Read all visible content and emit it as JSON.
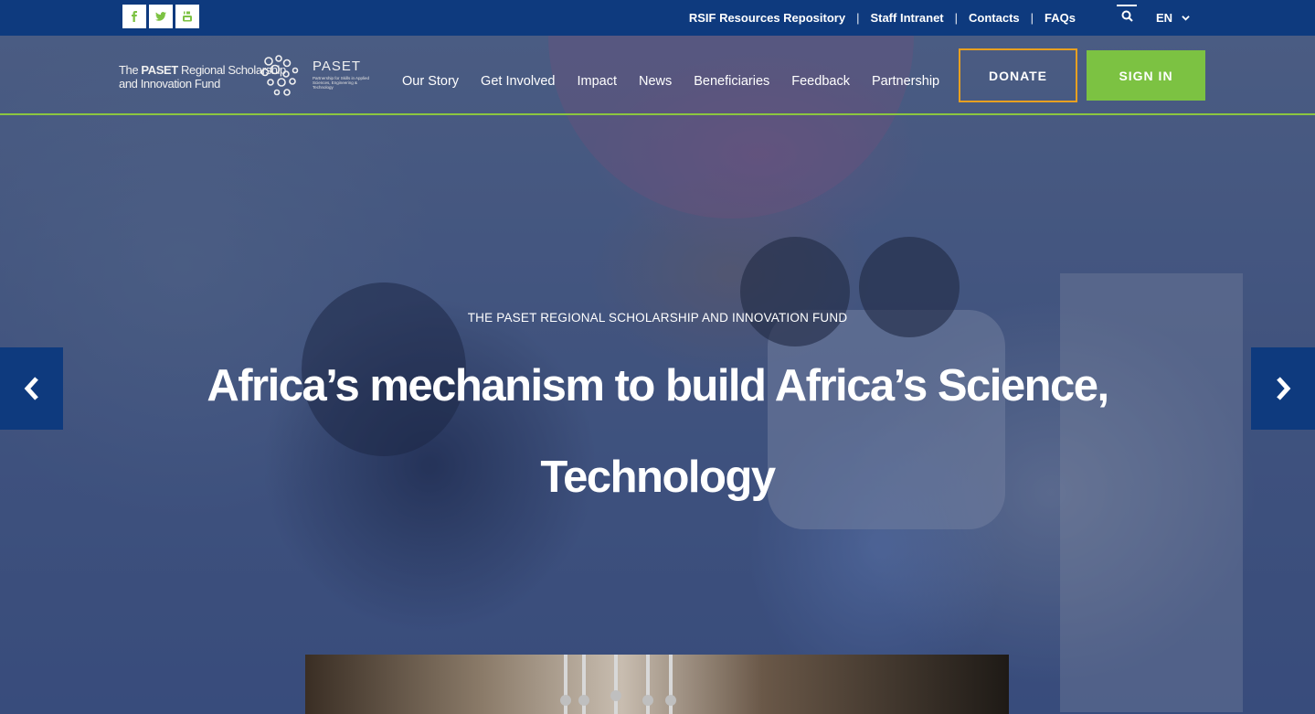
{
  "topbar": {
    "social": [
      {
        "icon": "facebook-icon"
      },
      {
        "icon": "twitter-icon"
      },
      {
        "icon": "youtube-icon"
      }
    ],
    "links": [
      {
        "label": "RSIF Resources Repository"
      },
      {
        "label": "Staff Intranet"
      },
      {
        "label": "Contacts"
      },
      {
        "label": "FAQs"
      }
    ],
    "separator": "|",
    "language": "EN"
  },
  "logo": {
    "line1_prefix": "The ",
    "line1_bold": "PASET",
    "line1_suffix": " Regional Scholarship",
    "line2": "and Innovation Fund",
    "paset": "PASET",
    "paset_sub": "Partnership for Skills in Applied Sciences, Engineering & Technology"
  },
  "nav": {
    "items": [
      {
        "label": "Our Story"
      },
      {
        "label": "Get Involved"
      },
      {
        "label": "Impact"
      },
      {
        "label": "News"
      },
      {
        "label": "Beneficiaries"
      },
      {
        "label": "Feedback"
      },
      {
        "label": "Partnership"
      }
    ],
    "donate": "DONATE",
    "signin": "SIGN IN"
  },
  "hero": {
    "eyebrow": "THE PASET REGIONAL SCHOLARSHIP AND INNOVATION FUND",
    "headline": "Africa’s mechanism to build Africa’s Science, Technology"
  },
  "colors": {
    "topbar": "#0e3a7e",
    "accent_green": "#7cc242",
    "donate_border": "#e8a020"
  }
}
